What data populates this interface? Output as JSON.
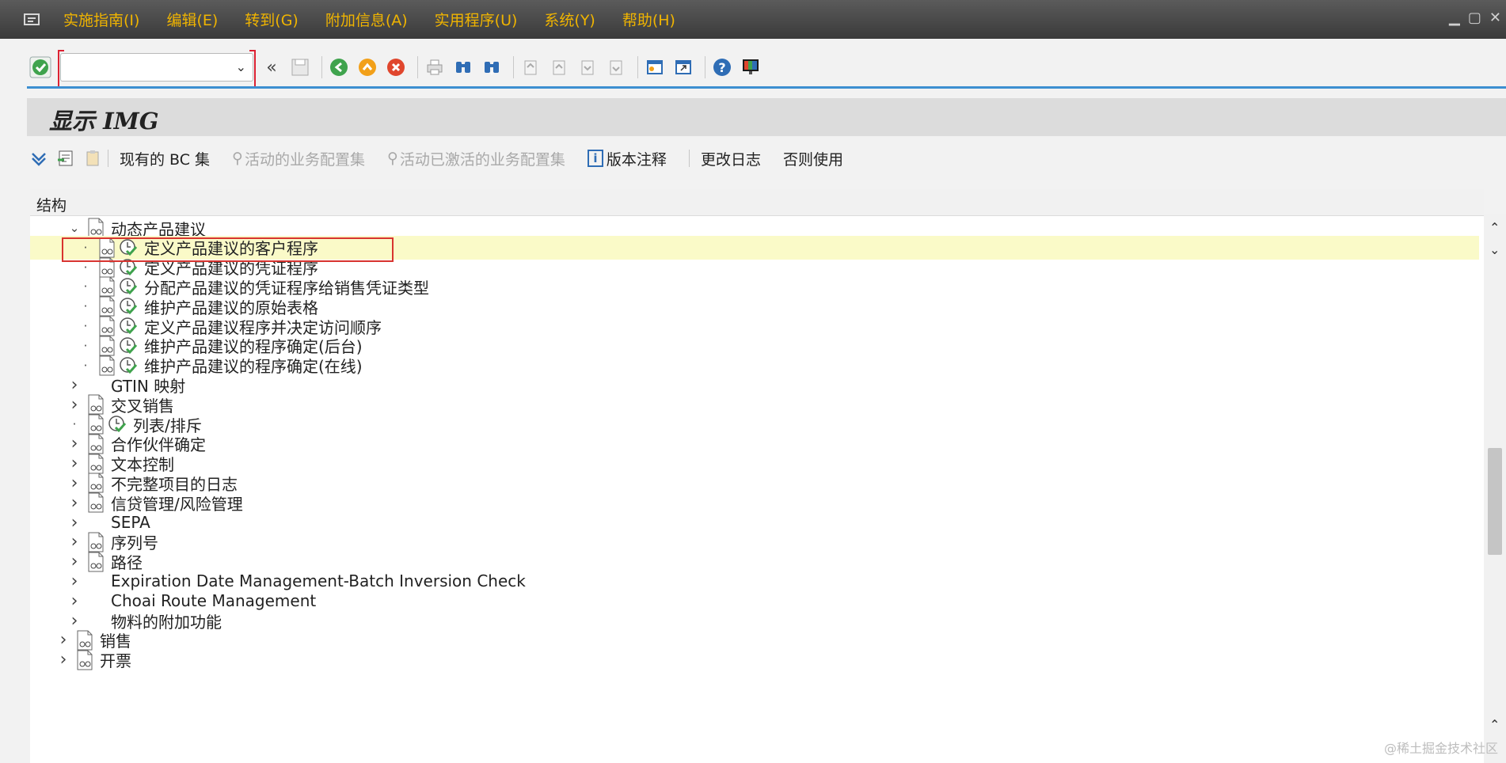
{
  "menubar": {
    "items": [
      "实施指南(I)",
      "编辑(E)",
      "转到(G)",
      "附加信息(A)",
      "实用程序(U)",
      "系统(Y)",
      "帮助(H)"
    ]
  },
  "toolbar": {
    "command_field_value": "",
    "icons": [
      "check-icon",
      "back-icon",
      "exit-icon",
      "cancel-icon",
      "print-icon",
      "find-icon",
      "find-next-icon",
      "first-page-icon",
      "prev-page-icon",
      "next-page-icon",
      "last-page-icon",
      "new-session-icon",
      "shortcut-icon",
      "help-icon",
      "customize-layout-icon"
    ]
  },
  "title": "显示 IMG",
  "app_toolbar": {
    "current_bc_set": "现有的 BC 集",
    "active_bc_sets": "活动的业务配置集",
    "activated_bc_sets": "活动已激活的业务配置集",
    "release_notes": "版本注释",
    "change_log": "更改日志",
    "otherwise_use": "否则使用"
  },
  "tree": {
    "header": "结构",
    "rows": [
      {
        "label": "动态产品建议",
        "level": 3,
        "state": "expanded",
        "doc": true,
        "exec": false
      },
      {
        "label": "定义产品建议的客户程序",
        "level": 4,
        "state": "leaf",
        "doc": true,
        "exec": true,
        "selected": true
      },
      {
        "label": "定义产品建议的凭证程序",
        "level": 4,
        "state": "leaf",
        "doc": true,
        "exec": true
      },
      {
        "label": "分配产品建议的凭证程序给销售凭证类型",
        "level": 4,
        "state": "leaf",
        "doc": true,
        "exec": true
      },
      {
        "label": "维护产品建议的原始表格",
        "level": 4,
        "state": "leaf",
        "doc": true,
        "exec": true
      },
      {
        "label": "定义产品建议程序并决定访问顺序",
        "level": 4,
        "state": "leaf",
        "doc": true,
        "exec": true
      },
      {
        "label": "维护产品建议的程序确定(后台)",
        "level": 4,
        "state": "leaf",
        "doc": true,
        "exec": true
      },
      {
        "label": "维护产品建议的程序确定(在线)",
        "level": 4,
        "state": "leaf",
        "doc": true,
        "exec": true
      },
      {
        "label": "GTIN 映射",
        "level": 3,
        "state": "collapsed",
        "doc": false,
        "exec": false
      },
      {
        "label": "交叉销售",
        "level": 3,
        "state": "collapsed",
        "doc": true,
        "exec": false
      },
      {
        "label": "列表/排斥",
        "level": 3,
        "state": "leaf",
        "doc": true,
        "exec": true
      },
      {
        "label": "合作伙伴确定",
        "level": 3,
        "state": "collapsed",
        "doc": true,
        "exec": false
      },
      {
        "label": "文本控制",
        "level": 3,
        "state": "collapsed",
        "doc": true,
        "exec": false
      },
      {
        "label": "不完整项目的日志",
        "level": 3,
        "state": "collapsed",
        "doc": true,
        "exec": false
      },
      {
        "label": "信贷管理/风险管理",
        "level": 3,
        "state": "collapsed",
        "doc": true,
        "exec": false
      },
      {
        "label": "SEPA",
        "level": 3,
        "state": "collapsed",
        "doc": false,
        "exec": false
      },
      {
        "label": "序列号",
        "level": 3,
        "state": "collapsed",
        "doc": true,
        "exec": false
      },
      {
        "label": "路径",
        "level": 3,
        "state": "collapsed",
        "doc": true,
        "exec": false
      },
      {
        "label": "Expiration Date Management-Batch Inversion Check",
        "level": 3,
        "state": "collapsed",
        "doc": false,
        "exec": false
      },
      {
        "label": "Choai Route Management",
        "level": 3,
        "state": "collapsed",
        "doc": false,
        "exec": false
      },
      {
        "label": "物料的附加功能",
        "level": 3,
        "state": "collapsed",
        "doc": false,
        "exec": false
      },
      {
        "label": "销售",
        "level": 2,
        "state": "collapsed",
        "doc": true,
        "exec": false
      },
      {
        "label": "开票",
        "level": 2,
        "state": "collapsed",
        "doc": true,
        "exec": false
      }
    ]
  },
  "watermark": "@稀土掘金技术社区",
  "colors": {
    "menu_text": "#f0b400",
    "accent_blue": "#3d8fd1",
    "selection_row": "#fafac8",
    "highlight_box": "#d8342f"
  }
}
